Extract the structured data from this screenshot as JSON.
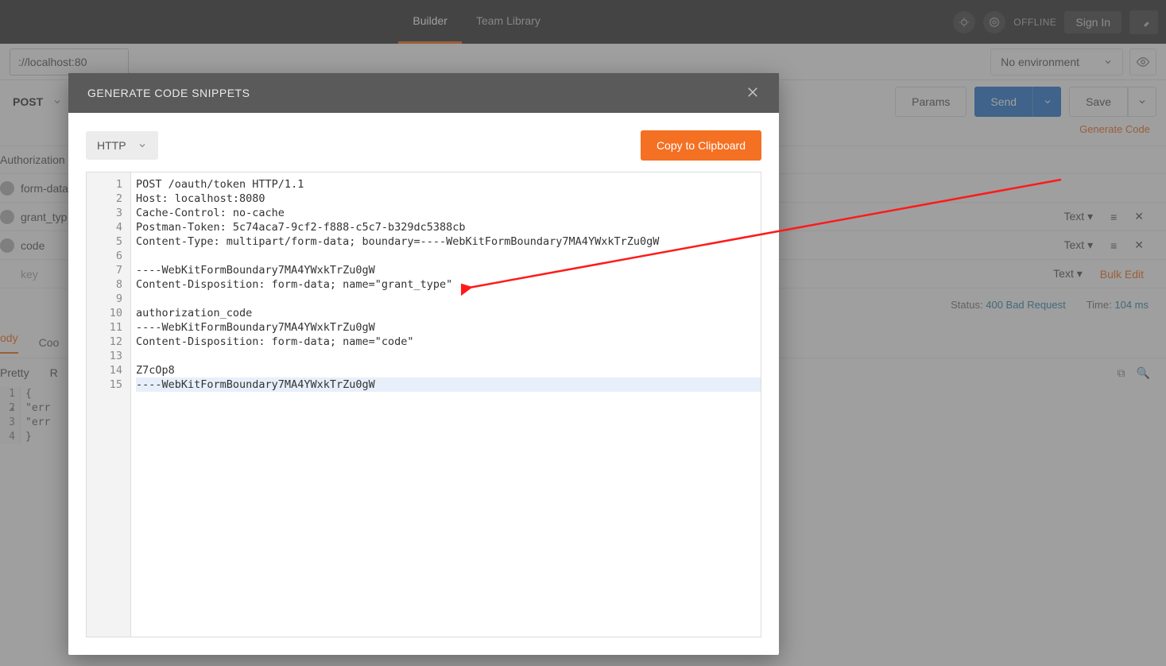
{
  "header": {
    "tabs": {
      "builder": "Builder",
      "library": "Team Library"
    },
    "offline": "OFFLINE",
    "signin": "Sign In"
  },
  "toolrow": {
    "url": "://localhost:80",
    "env": "No environment"
  },
  "request": {
    "method": "POST",
    "params_btn": "Params",
    "send_btn": "Send",
    "save_btn": "Save"
  },
  "generate_code_link": "Generate Code",
  "bg": {
    "authorization_tab": "Authorization",
    "formdata_tab": "form-data",
    "rows": [
      {
        "key": "grant_typ",
        "text": "Text ▾"
      },
      {
        "key": "code",
        "text": "Text ▾"
      },
      {
        "key": "key",
        "text": "Text ▾"
      }
    ],
    "bulk_edit": "Bulk Edit",
    "lower_tabs": {
      "body": "ody",
      "cookies": "Coo"
    },
    "status_label": "Status:",
    "status_value": "400 Bad Request",
    "time_label": "Time:",
    "time_value": "104 ms",
    "pretty": "Pretty",
    "raw_initial": "R",
    "resp_lines": [
      "{",
      "  \"err",
      "  \"err",
      "}"
    ]
  },
  "modal": {
    "title": "GENERATE CODE SNIPPETS",
    "lang": "HTTP",
    "copy_btn": "Copy to Clipboard",
    "code": [
      "POST /oauth/token HTTP/1.1",
      "Host: localhost:8080",
      "Cache-Control: no-cache",
      "Postman-Token: 5c74aca7-9cf2-f888-c5c7-b329dc5388cb",
      "Content-Type: multipart/form-data; boundary=----WebKitFormBoundary7MA4YWxkTrZu0gW",
      "",
      "----WebKitFormBoundary7MA4YWxkTrZu0gW",
      "Content-Disposition: form-data; name=\"grant_type\"",
      "",
      "authorization_code",
      "----WebKitFormBoundary7MA4YWxkTrZu0gW",
      "Content-Disposition: form-data; name=\"code\"",
      "",
      "Z7cOp8",
      "----WebKitFormBoundary7MA4YWxkTrZu0gW"
    ]
  }
}
